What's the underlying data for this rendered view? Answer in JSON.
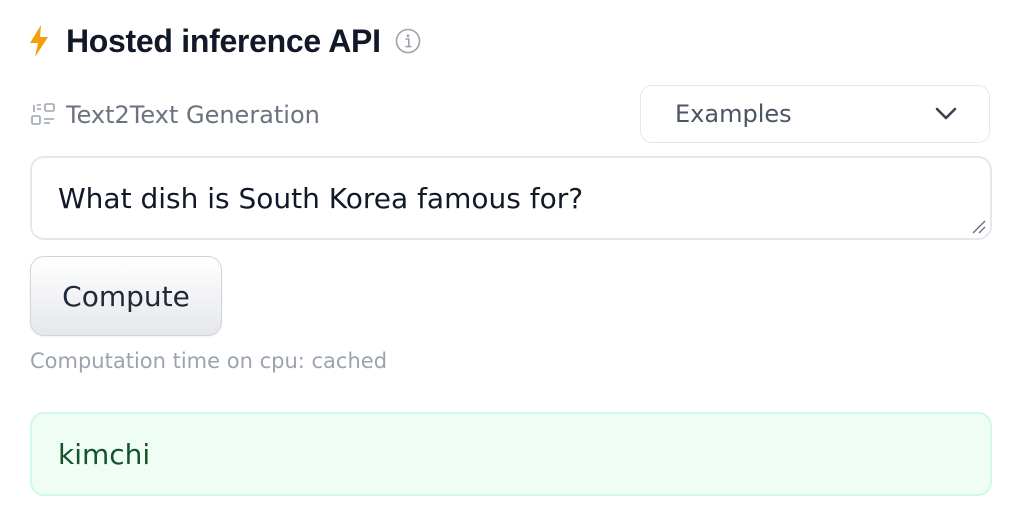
{
  "header": {
    "title": "Hosted inference API",
    "bolt_icon": "lightning-bolt-icon",
    "info_icon": "info-circle-icon"
  },
  "task": {
    "icon": "text2text-task-icon",
    "label": "Text2Text Generation"
  },
  "examples_dropdown": {
    "label": "Examples",
    "icon": "chevron-down-icon"
  },
  "input": {
    "value": "What dish is South Korea famous for?"
  },
  "compute_button": {
    "label": "Compute"
  },
  "status": {
    "timing_text": "Computation time on cpu: cached"
  },
  "output": {
    "text": "kimchi"
  },
  "colors": {
    "bolt": "#f59e0b",
    "output_background": "#f0fdf4",
    "output_border": "#d1fae5",
    "output_text": "#14532d"
  }
}
